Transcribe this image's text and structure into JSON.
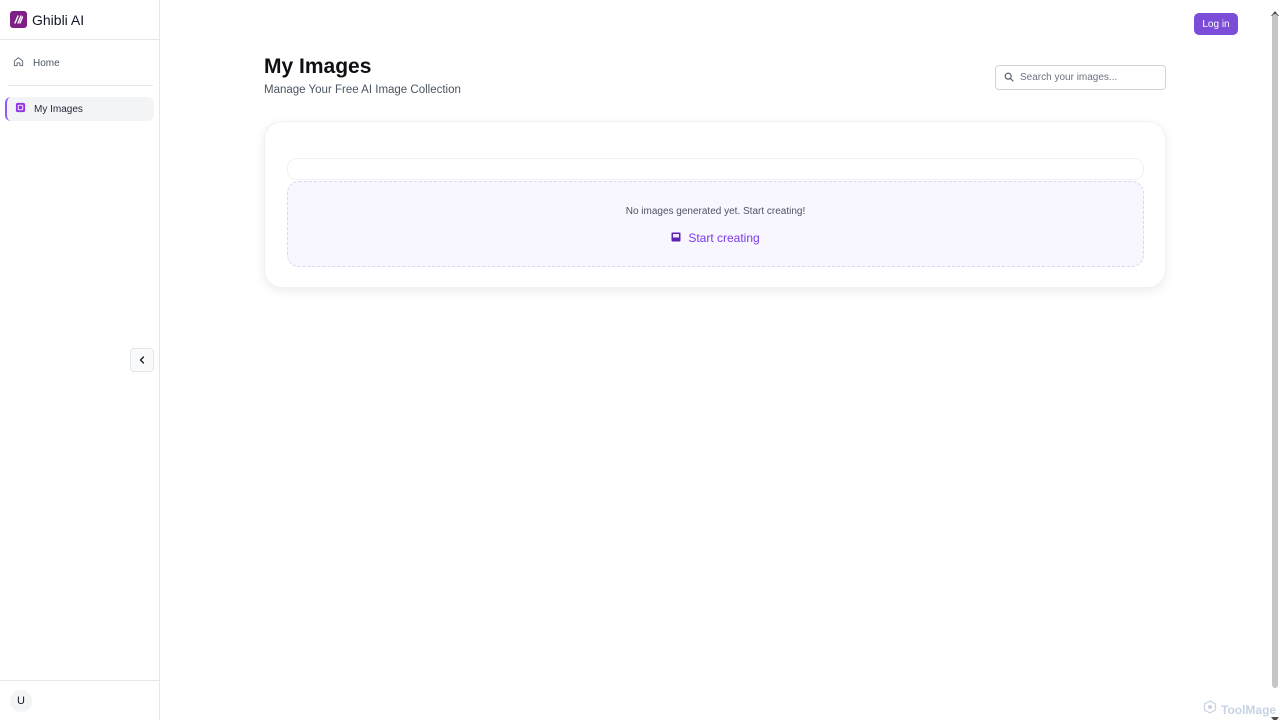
{
  "brand": {
    "name": "Ghibli AI",
    "logo_color": "#7e1f86"
  },
  "sidebar": {
    "items": [
      {
        "label": "Home",
        "icon": "home-icon"
      },
      {
        "label": "My Images",
        "icon": "image-icon",
        "active": true
      }
    ],
    "user_initial": "U"
  },
  "header": {
    "login_label": "Log in"
  },
  "main": {
    "title": "My Images",
    "subtitle": "Manage Your Free AI Image Collection",
    "search": {
      "placeholder": "Search your images...",
      "value": ""
    },
    "empty_state": {
      "message": "No images generated yet. Start creating!",
      "cta_label": "Start creating"
    }
  },
  "watermark": {
    "text": "ToolMage"
  },
  "colors": {
    "accent": "#7c4dd8",
    "link": "#7c3aed",
    "active_border": "#8b5cf6"
  }
}
